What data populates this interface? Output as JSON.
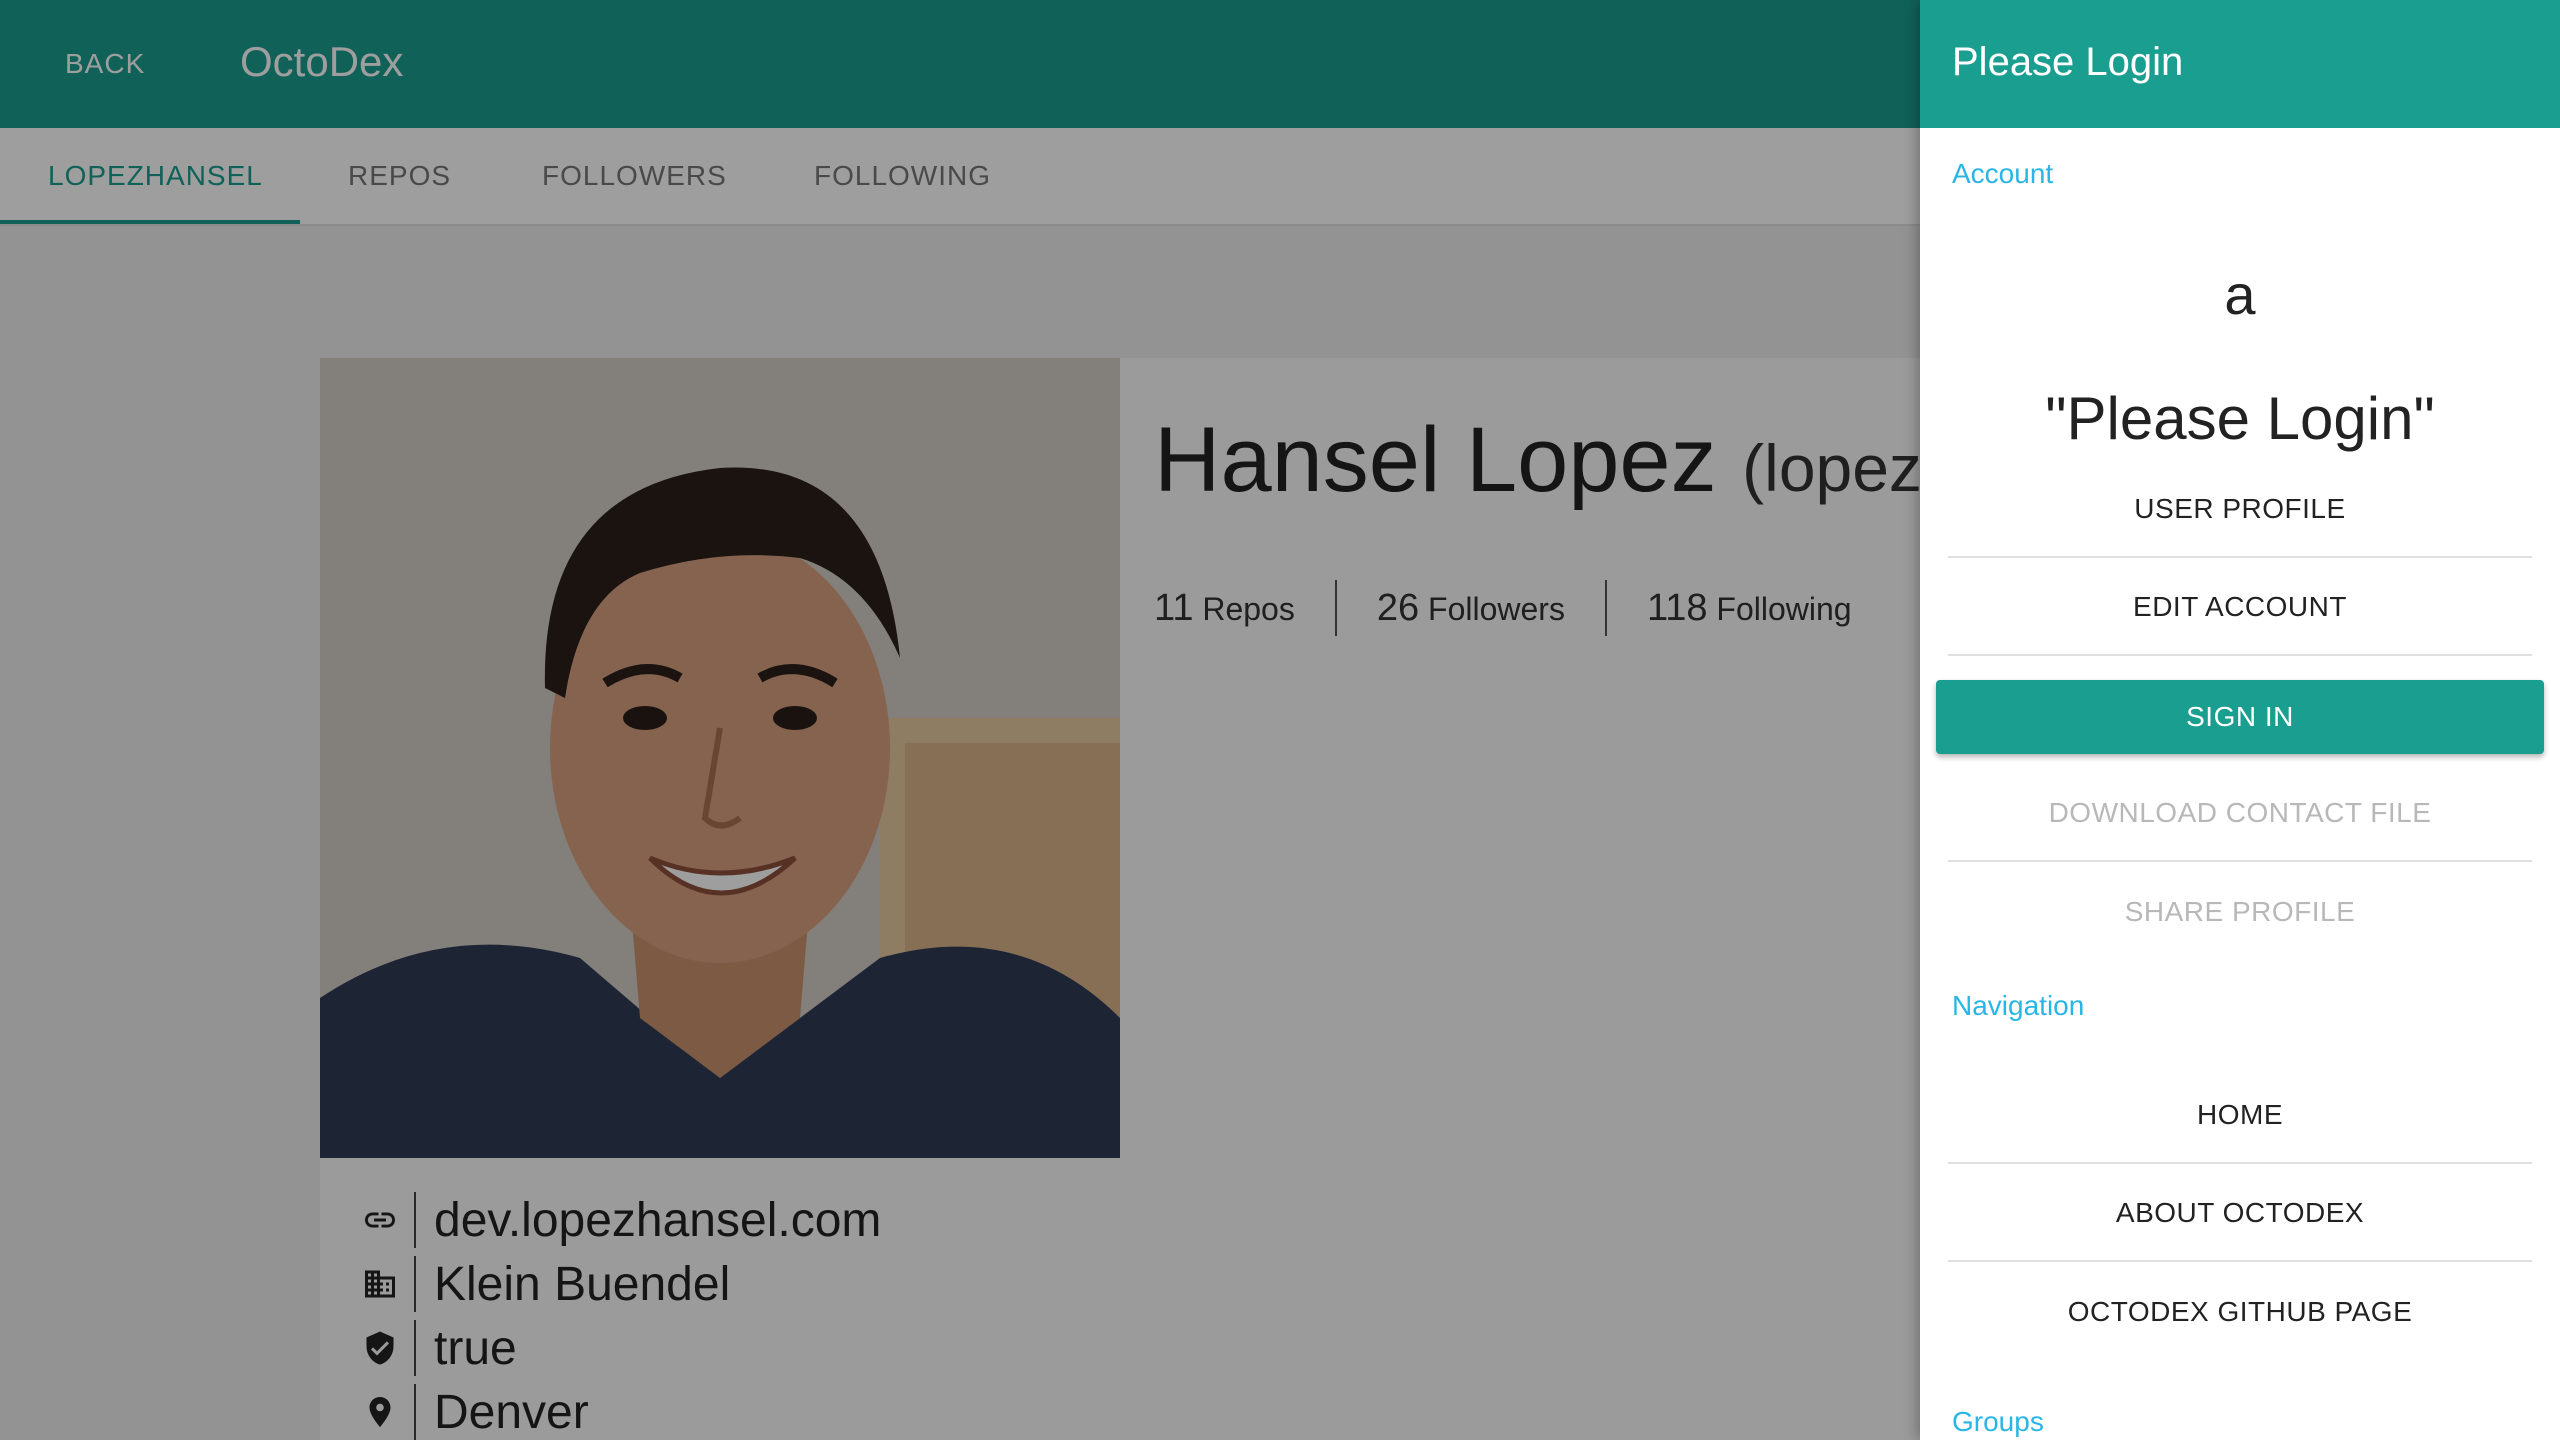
{
  "appbar": {
    "back_label": "BACK",
    "title": "OctoDex"
  },
  "tabs": [
    {
      "label": "LOPEZHANSEL",
      "active": true
    },
    {
      "label": "REPOS",
      "active": false
    },
    {
      "label": "FOLLOWERS",
      "active": false
    },
    {
      "label": "FOLLOWING",
      "active": false
    }
  ],
  "profile": {
    "name": "Hansel Lopez",
    "handle_visible": "(lopezl",
    "stats": [
      {
        "value": "11",
        "label": "Repos"
      },
      {
        "value": "26",
        "label": "Followers"
      },
      {
        "value": "118",
        "label": "Following"
      }
    ],
    "info": [
      {
        "icon": "link-icon",
        "text": "dev.lopezhansel.com"
      },
      {
        "icon": "building-icon",
        "text": "Klein Buendel"
      },
      {
        "icon": "verified-check-icon",
        "text": "true"
      },
      {
        "icon": "location-pin-icon",
        "text": "Denver"
      }
    ]
  },
  "drawer": {
    "title": "Please Login",
    "account_label": "Account",
    "avatar_letter": "a",
    "status_text": "\"Please Login\"",
    "account_items": [
      {
        "label": "USER PROFILE",
        "disabled": false
      },
      {
        "label": "EDIT ACCOUNT",
        "disabled": false
      }
    ],
    "sign_in_label": "SIGN IN",
    "disabled_items": [
      {
        "label": "DOWNLOAD CONTACT FILE",
        "disabled": true
      },
      {
        "label": "SHARE PROFILE",
        "disabled": true
      }
    ],
    "navigation_label": "Navigation",
    "navigation_items": [
      {
        "label": "HOME"
      },
      {
        "label": "ABOUT OCTODEX"
      },
      {
        "label": "OCTODEX GITHUB PAGE"
      }
    ],
    "groups_label": "Groups"
  },
  "colors": {
    "primary": "#1a9e8f",
    "section_label": "#29b6e6",
    "disabled_text": "#b8b8b8"
  }
}
